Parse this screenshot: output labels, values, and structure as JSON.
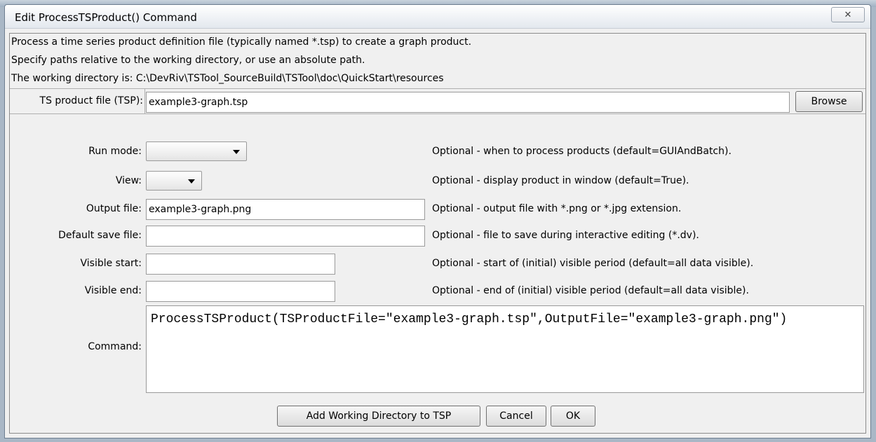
{
  "window": {
    "title": "Edit ProcessTSProduct() Command",
    "close_glyph": "✕"
  },
  "info": {
    "line1": "Process a time series product definition file (typically named *.tsp) to create a graph product.",
    "line2": "Specify paths relative to the working directory, or use an absolute path.",
    "line3": "The working directory is: C:\\DevRiv\\TSTool_SourceBuild\\TSTool\\doc\\QuickStart\\resources"
  },
  "tsp": {
    "label": "TS product file (TSP):",
    "value": "example3-graph.tsp",
    "browse": "Browse"
  },
  "run_mode": {
    "label": "Run mode:",
    "value": "",
    "note": "Optional - when to process products (default=GUIAndBatch)."
  },
  "view": {
    "label": "View:",
    "value": "",
    "note": "Optional - display product in window (default=True)."
  },
  "output_file": {
    "label": "Output file:",
    "value": "example3-graph.png",
    "note": "Optional - output file with *.png or *.jpg extension."
  },
  "default_save_file": {
    "label": "Default save file:",
    "value": "",
    "note": "Optional - file to save during interactive editing (*.dv)."
  },
  "visible_start": {
    "label": "Visible start:",
    "value": "",
    "note": "Optional - start of (initial) visible period (default=all data visible)."
  },
  "visible_end": {
    "label": "Visible end:",
    "value": "",
    "note": "Optional - end of (initial) visible period (default=all data visible)."
  },
  "command": {
    "label": "Command:",
    "value": "ProcessTSProduct(TSProductFile=\"example3-graph.tsp\",OutputFile=\"example3-graph.png\")"
  },
  "buttons": {
    "add_wd": "Add Working Directory to TSP",
    "cancel": "Cancel",
    "ok": "OK"
  }
}
